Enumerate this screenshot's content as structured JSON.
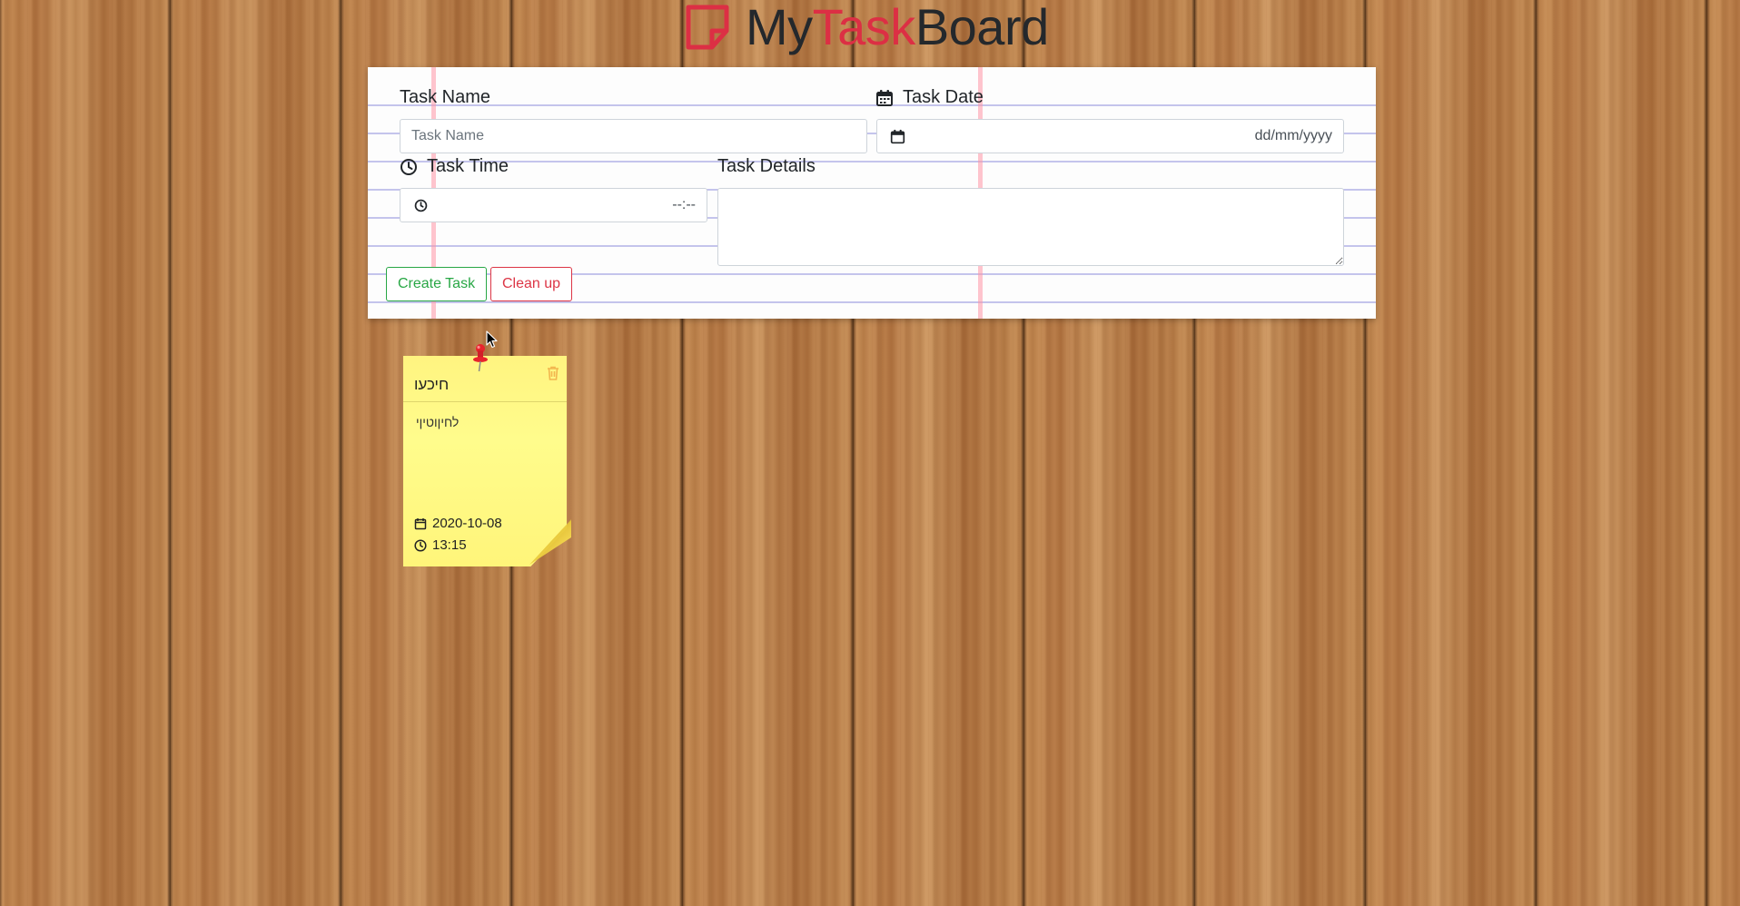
{
  "header": {
    "logo_my": "My",
    "logo_task": "Task",
    "logo_board": "Board",
    "logo_icon": "sticky-note-icon",
    "brand_color": "#dc2f44"
  },
  "form": {
    "task_name_label": "Task Name",
    "task_name_placeholder": "Task Name",
    "task_date_label": "Task Date",
    "task_date_placeholder": "dd/mm/yyyy",
    "task_time_label": "Task Time",
    "task_time_placeholder": "--:--",
    "task_details_label": "Task Details",
    "create_button": "Create Task",
    "cleanup_button": "Clean up",
    "create_color": "#28a745",
    "cleanup_color": "#dc3545"
  },
  "tasks": [
    {
      "title": "חיכעו",
      "details": "לחיןוטיןי",
      "date": "2020-10-08",
      "time": "13:15"
    }
  ]
}
